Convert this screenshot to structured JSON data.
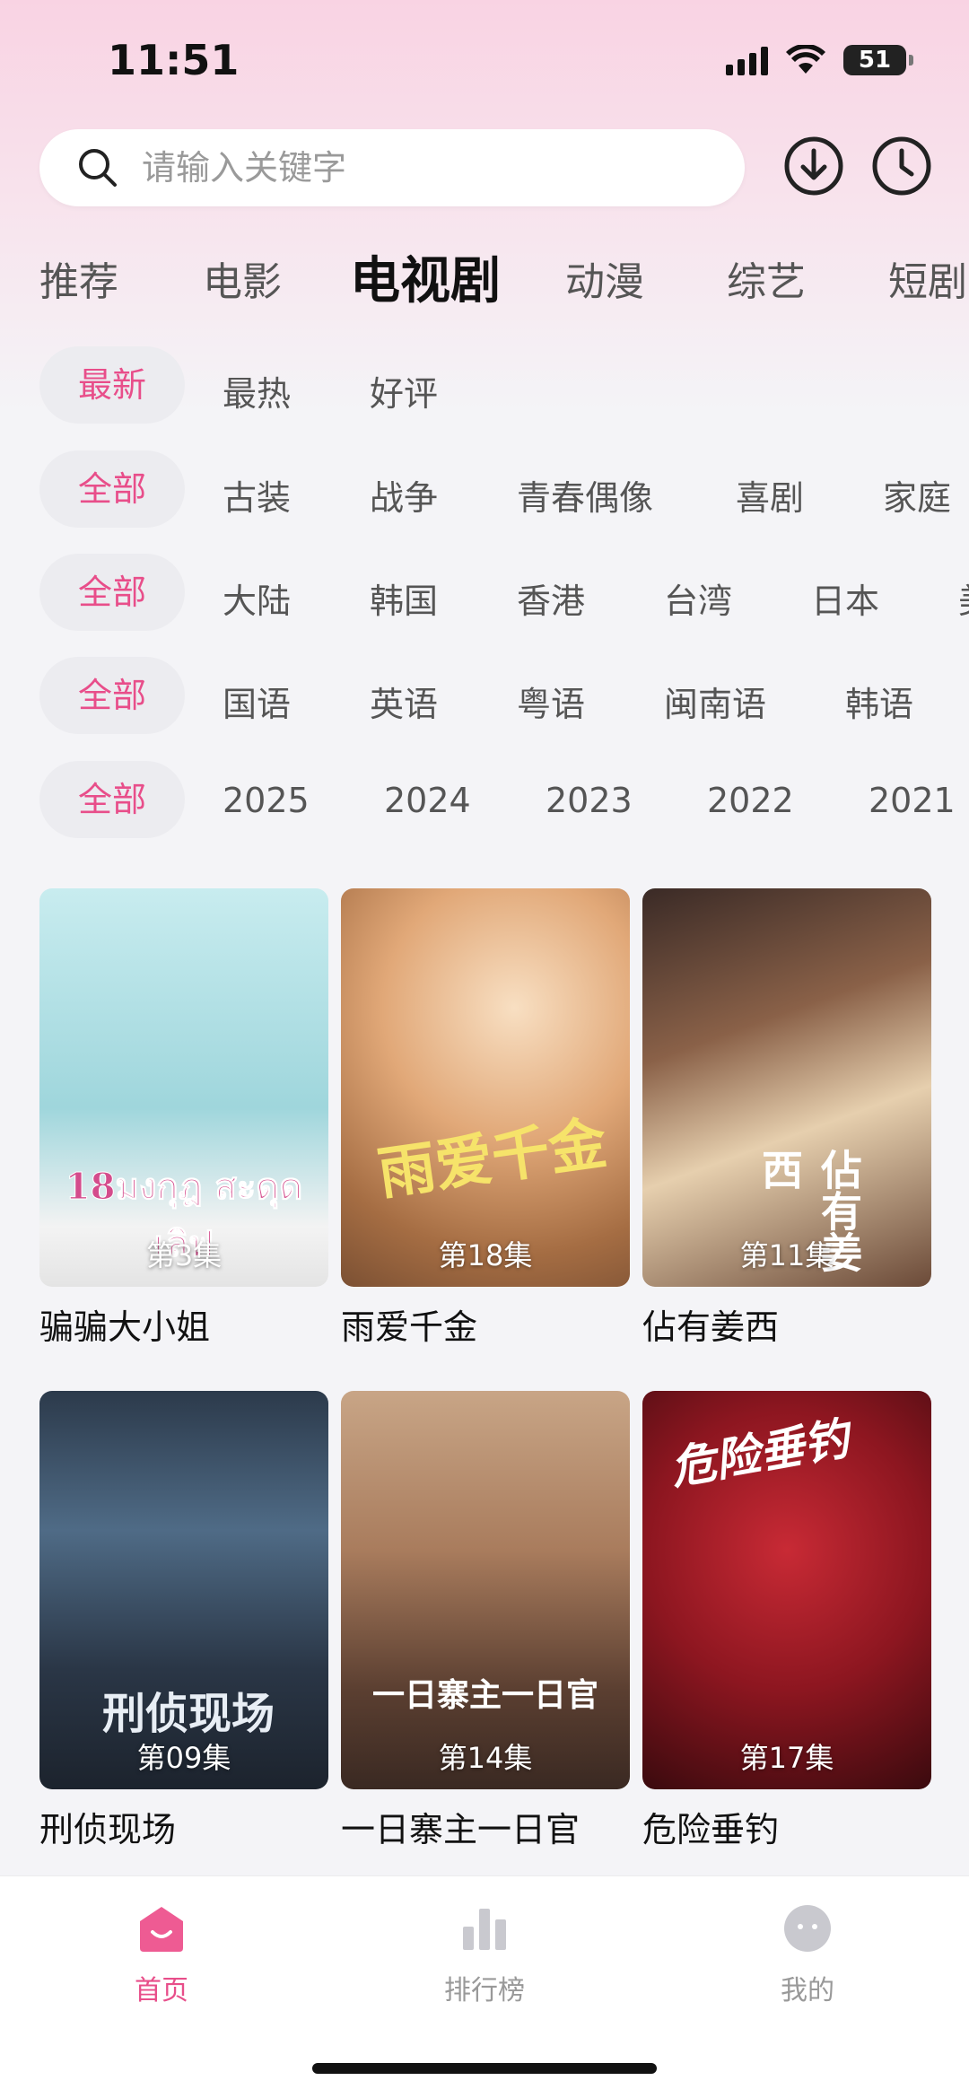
{
  "status_bar": {
    "time": "11:51",
    "battery": "51"
  },
  "search": {
    "placeholder": "请输入关键字"
  },
  "category_tabs": [
    "推荐",
    "电影",
    "电视剧",
    "动漫",
    "综艺",
    "短剧"
  ],
  "filters": {
    "sort": {
      "active": "最新",
      "options": [
        "最热",
        "好评"
      ]
    },
    "genre": {
      "active": "全部",
      "options": [
        "古装",
        "战争",
        "青春偶像",
        "喜剧",
        "家庭"
      ]
    },
    "region": {
      "active": "全部",
      "options": [
        "大陆",
        "韩国",
        "香港",
        "台湾",
        "日本",
        "美"
      ]
    },
    "language": {
      "active": "全部",
      "options": [
        "国语",
        "英语",
        "粤语",
        "闽南语",
        "韩语"
      ]
    },
    "year": {
      "active": "全部",
      "options": [
        "2025",
        "2024",
        "2023",
        "2022",
        "2021"
      ]
    }
  },
  "shows": [
    {
      "title": "骗骗大小姐",
      "episode": "第3集",
      "poster_text": "18มงกุฎ สะดุดเลิฟ",
      "colors": [
        "#bfe6ea",
        "#8fd0d8"
      ]
    },
    {
      "title": "雨爱千金",
      "episode": "第18集",
      "poster_text": "雨爱千金",
      "colors": [
        "#f3c9a0",
        "#c07c4c"
      ]
    },
    {
      "title": "佔有姜西",
      "episode": "第11集",
      "poster_text": "佔有姜西",
      "colors": [
        "#d9b48f",
        "#5d3b2e"
      ]
    },
    {
      "title": "刑侦现场",
      "episode": "第09集",
      "poster_text": "刑侦现场",
      "colors": [
        "#5b7088",
        "#23303f"
      ]
    },
    {
      "title": "一日寨主一日官",
      "episode": "第14集",
      "poster_text": "一日寨主一日官",
      "colors": [
        "#c59a78",
        "#4e3a2e"
      ]
    },
    {
      "title": "危险垂钓",
      "episode": "第17集",
      "poster_text": "危险垂钓",
      "colors": [
        "#b0202a",
        "#2a0c10"
      ]
    }
  ],
  "bottom_nav": [
    {
      "label": "首页",
      "icon": "home-icon",
      "active": true
    },
    {
      "label": "排行榜",
      "icon": "ranking-icon",
      "active": false
    },
    {
      "label": "我的",
      "icon": "profile-icon",
      "active": false
    }
  ],
  "accent_color": "#e84e8a"
}
